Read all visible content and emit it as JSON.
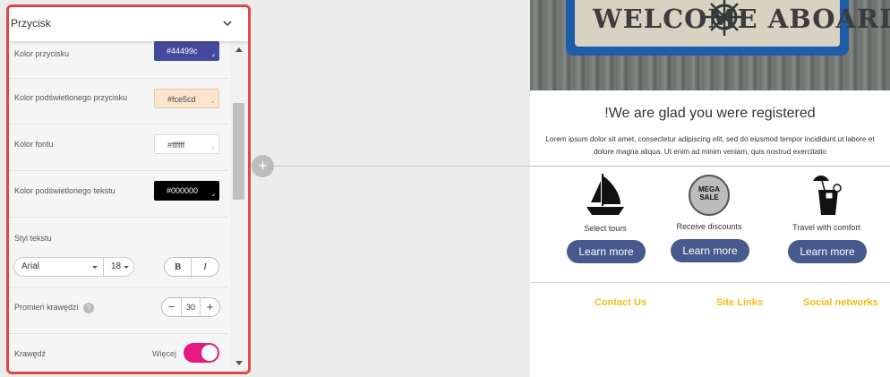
{
  "panel": {
    "title": "Przycisk",
    "rows": {
      "button_color": {
        "label": "Kolor przycisku",
        "value": "#44499c",
        "bg": "#44499c",
        "fg": "#ffffff"
      },
      "button_hover_color": {
        "label": "Kolor podświetlonego przycisku",
        "value": "#fce5cd",
        "bg": "#fce5cd",
        "fg": "#444444"
      },
      "font_color": {
        "label": "Kolor fontu",
        "value": "#ffffff",
        "bg": "#ffffff",
        "fg": "#444444"
      },
      "text_hover_color": {
        "label": "Kolor podświetlonego tekstu",
        "value": "#000000",
        "bg": "#000000",
        "fg": "#ffffff"
      }
    },
    "text_style": {
      "label": "Styl tekstu",
      "font": "Arial",
      "size": "18",
      "bold": "B",
      "italic": "I"
    },
    "radius": {
      "label": "Promień krawędzi",
      "help": "?",
      "minus": "−",
      "value": "30",
      "plus": "+"
    },
    "border": {
      "label": "Krawędź",
      "more": "Więcej",
      "toggle_on": true
    }
  },
  "canvas": {
    "add_symbol": "+"
  },
  "email": {
    "hero_text": "WELCOME ABOARD",
    "title": "!We are glad you were registered",
    "body": "Lorem ipsum dolor sit amet, consectetur adipiscing elit, sed do eiusmod tempor incididunt ut labore et dolore magna aliqua. Ut enim ad minim veniam, quis nostrud exercitatio",
    "features": [
      {
        "caption": "Select tours",
        "button": "Learn more",
        "icon": "sailboat-icon"
      },
      {
        "caption": "Receive discounts",
        "button": "Learn more",
        "icon": "mega-sale-badge-icon",
        "badge_line1": "MEGA",
        "badge_line2": "SALE"
      },
      {
        "caption": "Travel with comfort",
        "button": "Learn more",
        "icon": "cocktail-icon"
      }
    ],
    "footer": {
      "contact": "Contact Us",
      "links": "Site Links",
      "social": "Social networks"
    },
    "colors": {
      "button": "#485a8d",
      "footer_link": "#f5bd18"
    }
  }
}
